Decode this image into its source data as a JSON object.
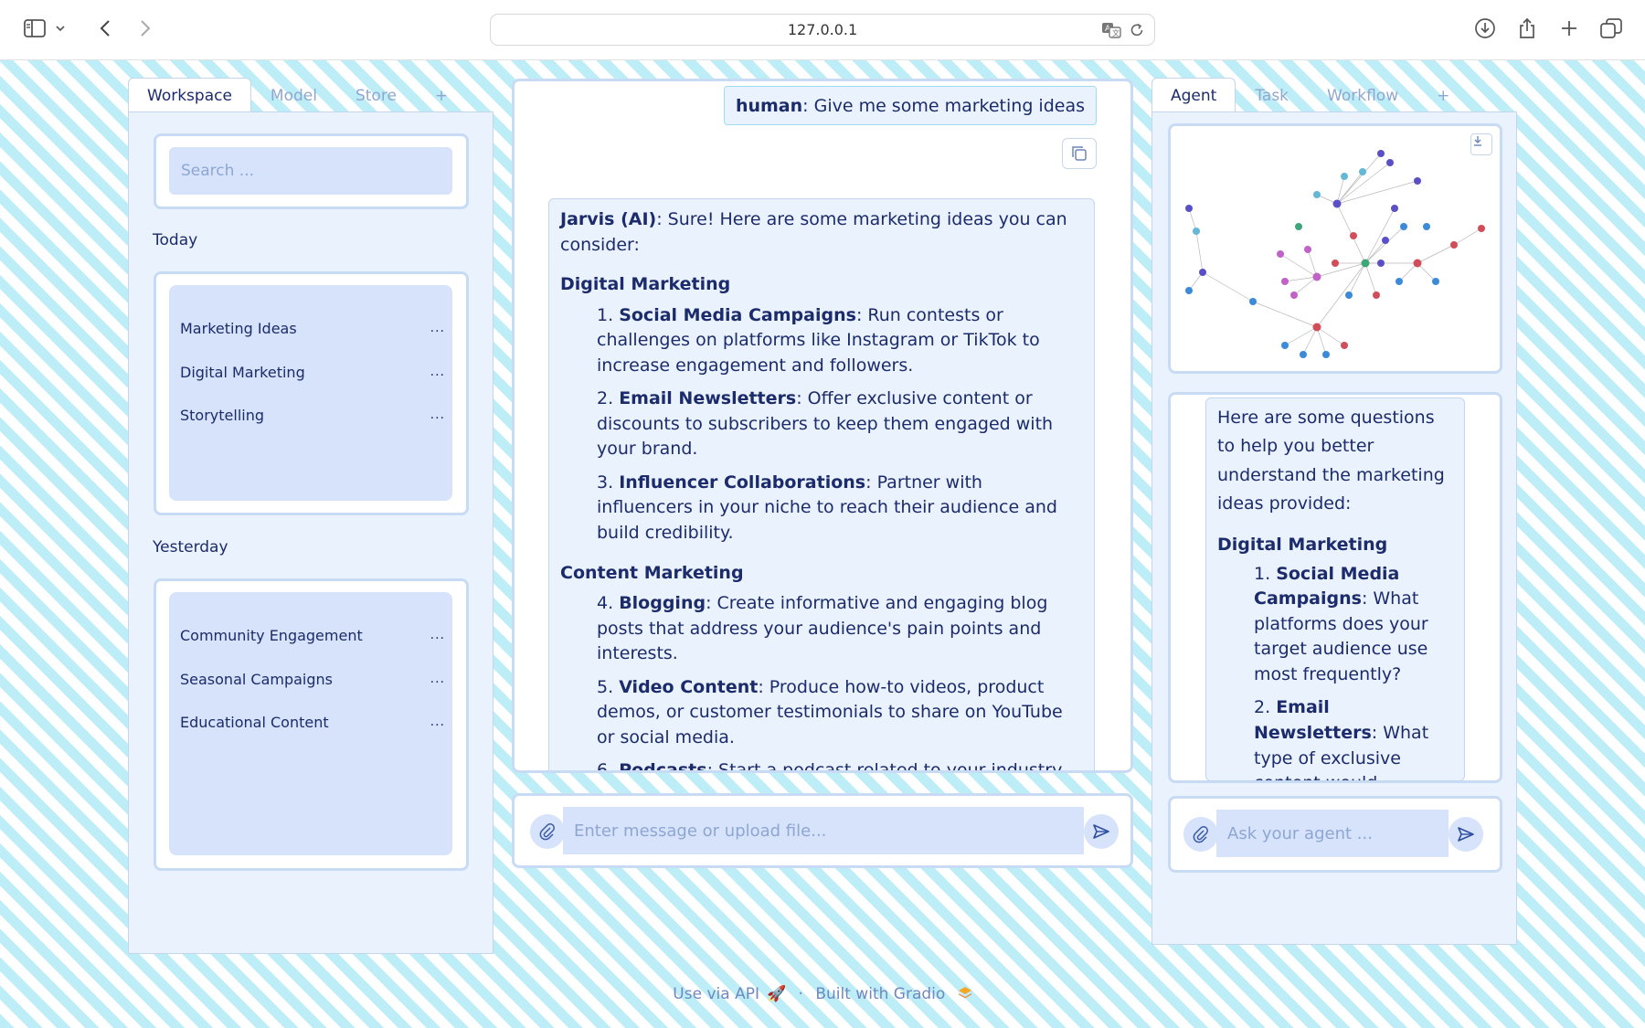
{
  "browser": {
    "url": "127.0.0.1",
    "icons": [
      "sidebar-icon",
      "chevron-down-icon",
      "back-icon",
      "forward-icon",
      "translate-icon",
      "reload-icon",
      "download-icon",
      "share-icon",
      "new-tab-icon",
      "tabs-overview-icon"
    ]
  },
  "left_panel": {
    "tabs": [
      "Workspace",
      "Model",
      "Store",
      "+"
    ],
    "active_tab": "Workspace",
    "search": {
      "placeholder": "Search ...",
      "value": ""
    },
    "groups": [
      {
        "label": "Today",
        "items": [
          "Marketing Ideas",
          "Digital Marketing",
          "Storytelling"
        ]
      },
      {
        "label": "Yesterday",
        "items": [
          "Community Engagement",
          "Seasonal Campaigns",
          "Educational Content"
        ]
      }
    ],
    "more_label": "..."
  },
  "chat": {
    "human_label": "human",
    "human_text": ": Give me some marketing ideas",
    "ai_label": "Jarvis (AI)",
    "ai_intro": ": Sure! Here are some marketing ideas you can consider:",
    "sections": [
      {
        "title": "Digital Marketing",
        "items": [
          {
            "num": "1.",
            "title": "Social Media Campaigns",
            "text": ": Run contests or challenges on platforms like Instagram or TikTok to increase engagement and followers."
          },
          {
            "num": "2.",
            "title": "Email Newsletters",
            "text": ": Offer exclusive content or discounts to subscribers to keep them engaged with your brand."
          },
          {
            "num": "3.",
            "title": "Influencer Collaborations",
            "text": ": Partner with influencers in your niche to reach their audience and build credibility."
          }
        ]
      },
      {
        "title": "Content Marketing",
        "items": [
          {
            "num": "4.",
            "title": "Blogging",
            "text": ": Create informative and engaging blog posts that address your audience's pain points and interests."
          },
          {
            "num": "5.",
            "title": "Video Content",
            "text": ": Produce how-to videos, product demos, or customer testimonials to share on YouTube or social media."
          },
          {
            "num": "6.",
            "title": "Podcasts",
            "text": ": Start a podcast related to your industry to establish thought leadership and connect with your audience."
          }
        ]
      }
    ],
    "composer_placeholder": "Enter message or upload file..."
  },
  "right_panel": {
    "tabs": [
      "Agent",
      "Task",
      "Workflow",
      "+"
    ],
    "active_tab": "Agent",
    "questions_intro": "Here are some questions to help you better understand the marketing ideas provided:",
    "questions_section": "Digital Marketing",
    "questions": [
      {
        "num": "1.",
        "title": "Social Media Campaigns",
        "text": ": What platforms does your target audience use most frequently?"
      },
      {
        "num": "2.",
        "title": "Email Newsletters",
        "text": ": What type of exclusive content would"
      }
    ],
    "composer_placeholder": "Ask your agent ..."
  },
  "footer": {
    "api_label": "Use via API",
    "separator": "·",
    "built_label": "Built with Gradio"
  },
  "colors": {
    "stripe": "#bdeef8",
    "panel": "#eaf2fd",
    "input_bg": "#d6e3fa",
    "text": "#1c2b6b",
    "placeholder": "#8ea6d4"
  }
}
